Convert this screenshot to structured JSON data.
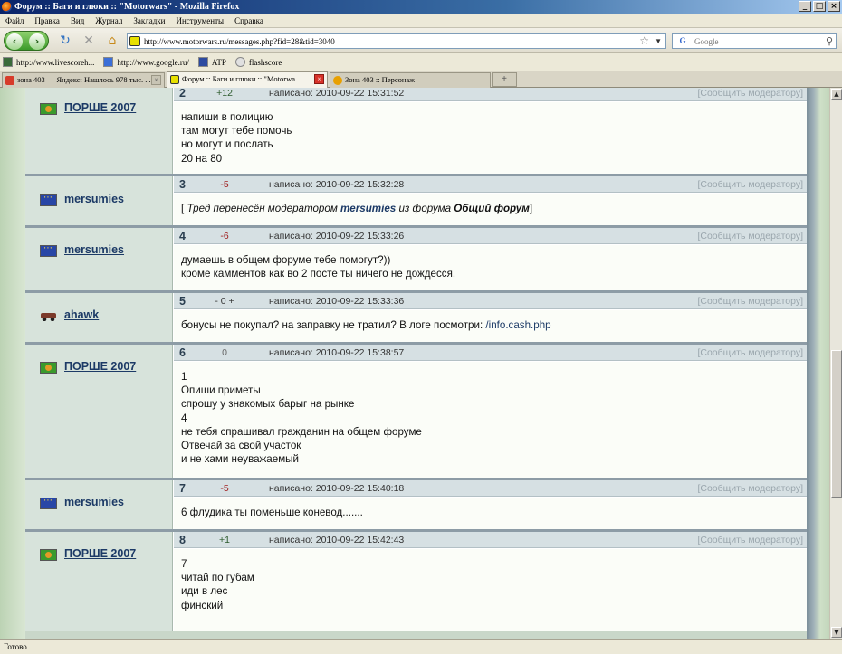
{
  "window": {
    "title": "Форум :: Баги и глюки :: \"Motorwars\" - Mozilla Firefox"
  },
  "menu": [
    "Файл",
    "Правка",
    "Вид",
    "Журнал",
    "Закладки",
    "Инструменты",
    "Справка"
  ],
  "nav": {
    "url": "http://www.motorwars.ru/messages.php?fid=28&tid=3040",
    "search_placeholder": "Google",
    "search_engine_label": "G"
  },
  "bookmarks": [
    {
      "label": "http://www.livescoreh...",
      "icon": "livescore-icon",
      "color": "#3a6a3a"
    },
    {
      "label": "http://www.google.ru/",
      "icon": "google-icon",
      "color": "#3b6fd8"
    },
    {
      "label": "ATP",
      "icon": "atp-icon",
      "color": "#2c4aa0"
    },
    {
      "label": "flashscore",
      "icon": "flashscore-icon",
      "color": "#e0e0e0"
    }
  ],
  "tabs": [
    {
      "label": "зона 403 — Яндекс: Нашлось 978 тыс. ...",
      "active": false,
      "icon_color": "#d73b2a"
    },
    {
      "label": "Форум :: Баги и глюки :: \"Motorwa...",
      "active": true,
      "icon_color": "#e8e000"
    },
    {
      "label": "Зона 403 :: Персонаж",
      "active": false,
      "icon_color": "#e8a000"
    }
  ],
  "newtab_label": "+",
  "posts": [
    {
      "num": "2",
      "rating": "+12",
      "rating_type": "plus",
      "author": "ПОРШЕ 2007",
      "flag": "porsche",
      "posted": "написано: 2010-09-22 15:31:52",
      "lines": [
        "напиши в полицию",
        "там могут тебе помочь",
        "но могут и послать",
        "20 на 80"
      ]
    },
    {
      "num": "3",
      "rating": "-5",
      "rating_type": "minus",
      "author": "mersumies",
      "flag": "eu",
      "posted": "написано: 2010-09-22 15:32:28",
      "system": {
        "open": "[ ",
        "pre": "Тред перенесён модератором ",
        "moderator": "mersumies",
        "mid": " из форума ",
        "forum": "Общий форум",
        "close": "]"
      }
    },
    {
      "num": "4",
      "rating": "-6",
      "rating_type": "minus",
      "author": "mersumies",
      "flag": "eu",
      "posted": "написано: 2010-09-22 15:33:26",
      "lines": [
        "думаешь в общем форуме тебе помогут?))",
        "кроме камментов как во 2 посте ты ничего не дождесся."
      ]
    },
    {
      "num": "5",
      "rating": "- 0 +",
      "rating_type": "neutral",
      "author": "ahawk",
      "flag": "car",
      "posted": "написано: 2010-09-22 15:33:36",
      "text_pre": "бонусы не покупал? на заправку не тратил? В логе посмотри: ",
      "link": "/info.cash.php"
    },
    {
      "num": "6",
      "rating": "0",
      "rating_type": "zero",
      "author": "ПОРШЕ 2007",
      "flag": "porsche",
      "posted": "написано: 2010-09-22 15:38:57",
      "lines": [
        "1",
        "Опиши приметы",
        "спрошу у знакомых барыг на рынке",
        "4",
        "не тебя спрашивал гражданин на общем форуме",
        "Отвечай за свой участок",
        "и не хами неуважаемый"
      ]
    },
    {
      "num": "7",
      "rating": "-5",
      "rating_type": "minus",
      "author": "mersumies",
      "flag": "eu",
      "posted": "написано: 2010-09-22 15:40:18",
      "lines": [
        "6 флудика ты поменьше коневод......."
      ]
    },
    {
      "num": "8",
      "rating": "+1",
      "rating_type": "plus",
      "author": "ПОРШЕ 2007",
      "flag": "porsche",
      "posted": "написано: 2010-09-22 15:42:43",
      "lines": [
        "7",
        "читай по губам",
        "иди в лес",
        "финский"
      ]
    }
  ],
  "report_label": "[Сообщить модератору]",
  "status": "Готово"
}
